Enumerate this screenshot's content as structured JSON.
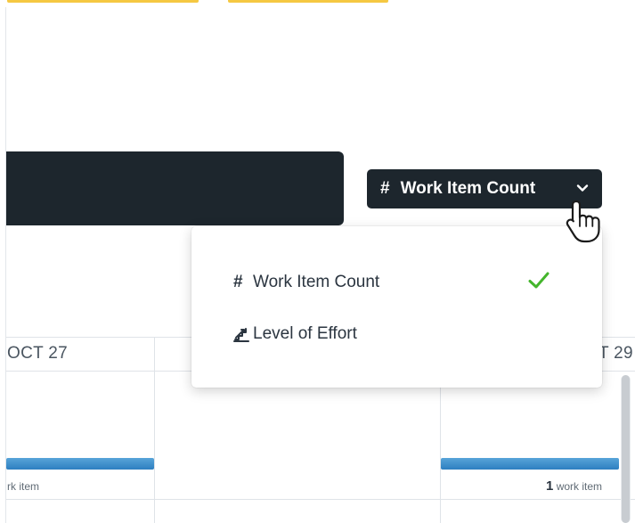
{
  "toolbar": {
    "metric_button": {
      "icon": "hash-icon",
      "label": "Work Item Count",
      "chevron": "chevron-down-icon"
    }
  },
  "dropdown": {
    "items": [
      {
        "icon": "hash-icon",
        "icon_glyph": "#",
        "label": "Work Item Count",
        "selected": true
      },
      {
        "icon": "stairs-icon",
        "label": "Level of Effort",
        "selected": false
      }
    ],
    "check_color": "#44b52c"
  },
  "calendar": {
    "days": [
      {
        "label": "OCT 27",
        "count_label": "rk item"
      },
      {
        "label": "T 29",
        "count": "1",
        "count_label": "work item"
      }
    ]
  },
  "colors": {
    "dark_bar": "#1d262d",
    "accent_yellow": "#f5c842",
    "bar_blue": "#3a8ccc"
  }
}
